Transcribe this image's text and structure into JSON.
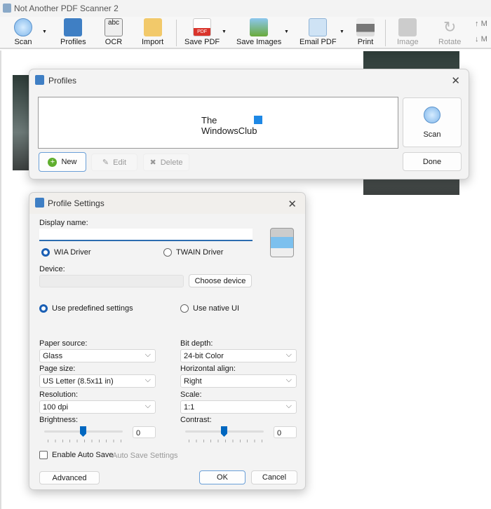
{
  "app": {
    "title": "Not Another PDF Scanner 2"
  },
  "toolbar": {
    "items": [
      {
        "label": "Scan"
      },
      {
        "label": "Profiles"
      },
      {
        "label": "OCR"
      },
      {
        "label": "Import"
      },
      {
        "label": "Save PDF"
      },
      {
        "label": "Save Images"
      },
      {
        "label": "Email PDF"
      },
      {
        "label": "Print"
      },
      {
        "label": "Image"
      },
      {
        "label": "Rotate"
      },
      {
        "label": "M"
      },
      {
        "label": "M"
      }
    ],
    "pdf_badge": "PDF",
    "ocr_glyph": "abc"
  },
  "profiles": {
    "title": "Profiles",
    "logo_line1": "The",
    "logo_line2": "WindowsClub",
    "scan": "Scan",
    "done": "Done",
    "new": "New",
    "edit": "Edit",
    "delete": "Delete"
  },
  "settings": {
    "title": "Profile Settings",
    "display_name_label": "Display name:",
    "display_name_value": "",
    "wia": "WIA Driver",
    "twain": "TWAIN Driver",
    "device_label": "Device:",
    "device_value": "",
    "choose_device": "Choose device",
    "predefined": "Use predefined settings",
    "native": "Use native UI",
    "paper_source_label": "Paper source:",
    "paper_source": "Glass",
    "page_size_label": "Page size:",
    "page_size": "US Letter (8.5x11 in)",
    "resolution_label": "Resolution:",
    "resolution": "100 dpi",
    "brightness_label": "Brightness:",
    "brightness": "0",
    "bit_depth_label": "Bit depth:",
    "bit_depth": "24-bit Color",
    "halign_label": "Horizontal align:",
    "halign": "Right",
    "scale_label": "Scale:",
    "scale": "1:1",
    "contrast_label": "Contrast:",
    "contrast": "0",
    "auto_save": "Enable Auto Save",
    "auto_save_settings": "Auto Save Settings",
    "advanced": "Advanced",
    "ok": "OK",
    "cancel": "Cancel"
  },
  "colors": {
    "accent": "#0067c0"
  }
}
